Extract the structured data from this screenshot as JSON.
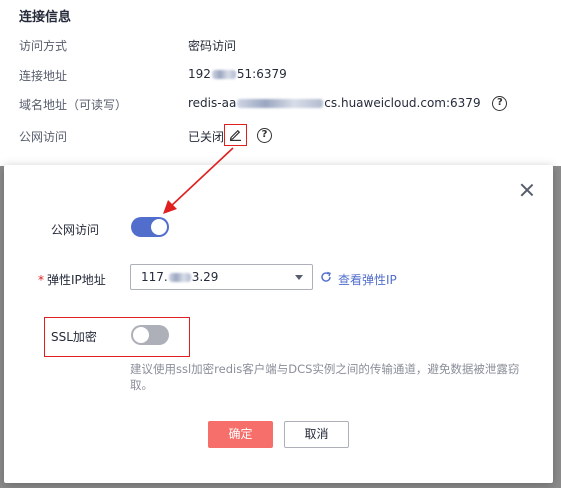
{
  "connection_info": {
    "title": "连接信息",
    "rows": [
      {
        "label": "访问方式",
        "value": "密码访问"
      },
      {
        "label": "连接地址",
        "value_prefix": "192",
        "value_suffix": "51:6379"
      },
      {
        "label": "域名地址（可读写）",
        "value_prefix": "redis-aa",
        "value_suffix": "cs.huaweicloud.com:6379"
      },
      {
        "label": "公网访问",
        "value": "已关闭"
      }
    ]
  },
  "icons": {
    "help": "question-circle-icon",
    "edit": "pencil-edit-icon",
    "close": "close-icon",
    "refresh": "refresh-icon",
    "dropdown": "chevron-down-icon"
  },
  "dialog": {
    "public_access_label": "公网访问",
    "public_access_on": true,
    "elastic_ip_label": "弹性IP地址",
    "elastic_ip_prefix": "117.",
    "elastic_ip_suffix": "3.29",
    "view_elastic_ip_link": "查看弹性IP",
    "ssl_label": "SSL加密",
    "ssl_on": false,
    "ssl_hint": "建议使用ssl加密redis客户端与DCS实例之间的传输通道，避免数据被泄露窃取。",
    "confirm_label": "确定",
    "cancel_label": "取消"
  },
  "colors": {
    "primary": "#526ecc",
    "danger_button": "#f66f6a",
    "annotation_red": "#e02020",
    "required_star": "#e02020"
  }
}
